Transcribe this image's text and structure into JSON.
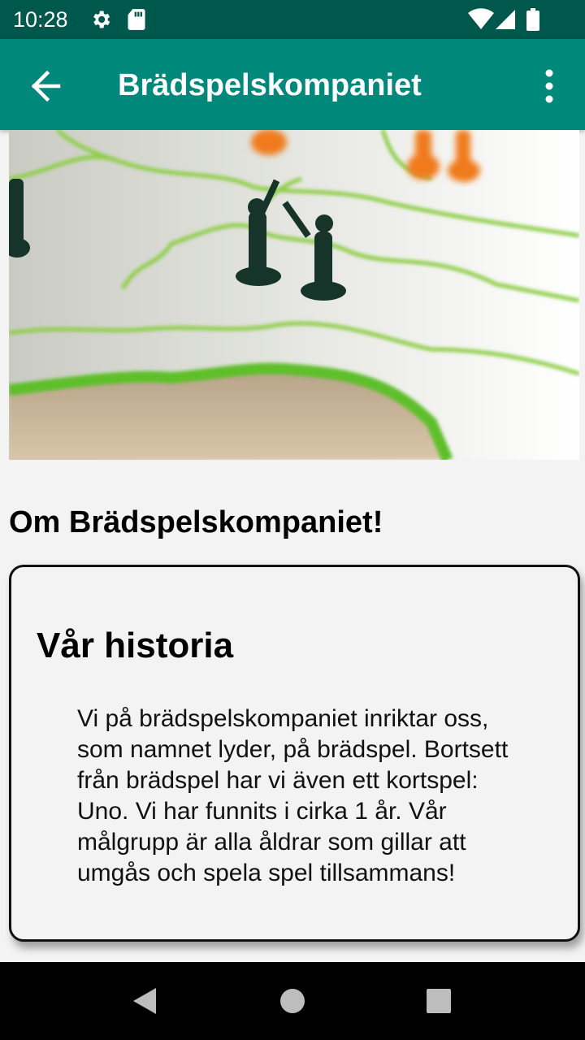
{
  "status_bar": {
    "time": "10:28",
    "icons": [
      "gear-icon",
      "sd-card-icon",
      "wifi-icon",
      "signal-icon",
      "battery-icon"
    ]
  },
  "app_bar": {
    "title": "Brädspelskompaniet",
    "back_icon": "arrow-back-icon",
    "menu_icon": "more-vert-icon"
  },
  "hero_image": {
    "description_icon": "board-game-photo"
  },
  "main": {
    "section_title": "Om Brädspelskompaniet!",
    "card": {
      "title": "Vår historia",
      "body": "Vi på brädspelskompaniet inriktar oss, som namnet lyder, på brädspel. Bortsett från brädspel har vi även ett kortspel: Uno. Vi har funnits i cirka 1 år. Vår målgrupp är alla åldrar som gillar att umgås och spela spel tillsammans!"
    }
  },
  "nav_bar": {
    "back_icon": "nav-back-icon",
    "home_icon": "nav-home-icon",
    "recents_icon": "nav-recents-icon"
  },
  "colors": {
    "status_bar": "#00574b",
    "app_bar": "#00897b",
    "background": "#f3f3f3"
  }
}
